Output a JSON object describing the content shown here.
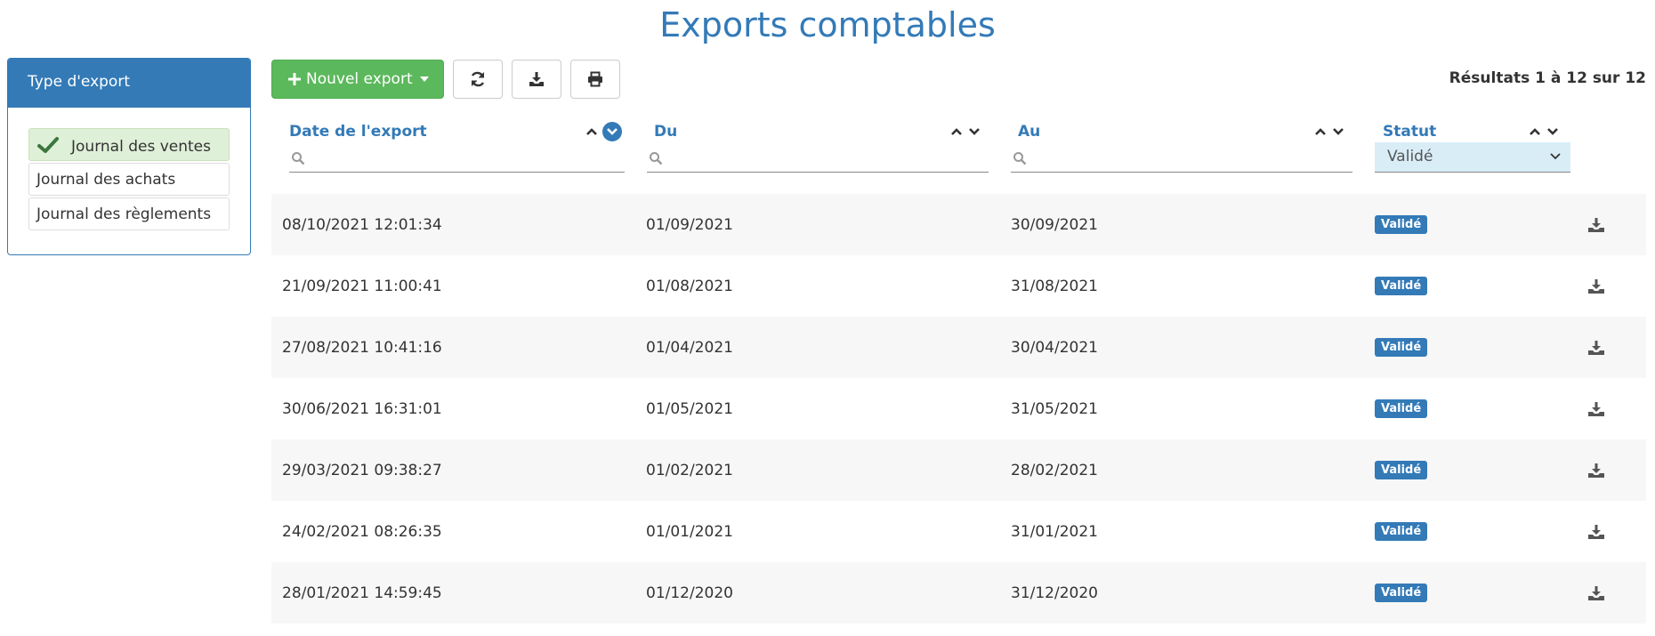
{
  "page": {
    "title": "Exports comptables"
  },
  "sidebar": {
    "title": "Type d'export",
    "items": [
      {
        "label": "Journal des ventes",
        "active": true
      },
      {
        "label": "Journal des achats",
        "active": false
      },
      {
        "label": "Journal des règlements",
        "active": false
      }
    ]
  },
  "toolbar": {
    "new_export_label": "Nouvel export",
    "icons": [
      "plus-icon",
      "caret-down-icon",
      "refresh-icon",
      "download-icon",
      "print-icon"
    ]
  },
  "results": {
    "text": "Résultats 1 à 12 sur 12"
  },
  "table": {
    "columns": {
      "date": {
        "label": "Date de l'export",
        "search_value": ""
      },
      "du": {
        "label": "Du",
        "search_value": ""
      },
      "au": {
        "label": "Au",
        "search_value": ""
      },
      "status": {
        "label": "Statut",
        "selected": "Validé"
      }
    },
    "rows": [
      {
        "date": "08/10/2021 12:01:34",
        "du": "01/09/2021",
        "au": "30/09/2021",
        "status": "Validé"
      },
      {
        "date": "21/09/2021 11:00:41",
        "du": "01/08/2021",
        "au": "31/08/2021",
        "status": "Validé"
      },
      {
        "date": "27/08/2021 10:41:16",
        "du": "01/04/2021",
        "au": "30/04/2021",
        "status": "Validé"
      },
      {
        "date": "30/06/2021 16:31:01",
        "du": "01/05/2021",
        "au": "31/05/2021",
        "status": "Validé"
      },
      {
        "date": "29/03/2021 09:38:27",
        "du": "01/02/2021",
        "au": "28/02/2021",
        "status": "Validé"
      },
      {
        "date": "24/02/2021 08:26:35",
        "du": "01/01/2021",
        "au": "31/01/2021",
        "status": "Validé"
      },
      {
        "date": "28/01/2021 14:59:45",
        "du": "01/12/2020",
        "au": "31/12/2020",
        "status": "Validé"
      }
    ]
  },
  "colors": {
    "primary": "#337ab7",
    "success": "#5cb85c",
    "active_item": "#dff0d8",
    "select_bg": "#d9edf7",
    "row_stripe": "#f7f7f7"
  }
}
